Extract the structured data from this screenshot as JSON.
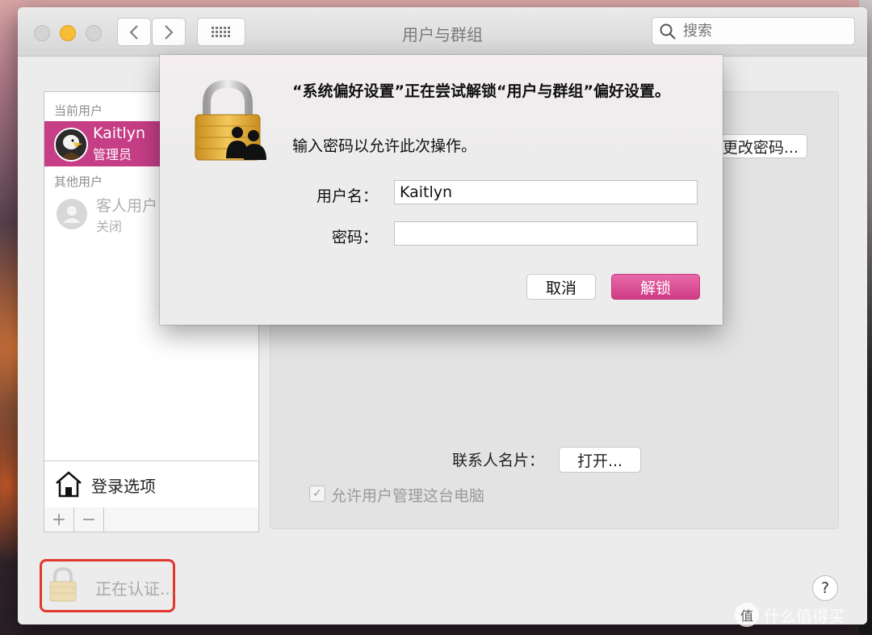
{
  "window": {
    "title": "用户与群组",
    "search_placeholder": "搜索"
  },
  "sidebar": {
    "current_user_label": "当前用户",
    "current_user": {
      "name": "Kaitlyn",
      "role": "管理员"
    },
    "other_users_label": "其他用户",
    "guest_user": {
      "name": "客人用户",
      "status": "关闭"
    },
    "login_options_label": "登录选项",
    "add_label": "+",
    "remove_label": "−"
  },
  "content": {
    "change_password_label": "更改密码...",
    "contact_card_label": "联系人名片：",
    "open_button_label": "打开...",
    "allow_admin_label": "允许用户管理这台电脑",
    "allow_admin_checked": true
  },
  "dialog": {
    "message": "“系统偏好设置”正在尝试解锁“用户与群组”偏好设置。",
    "sub_message": "输入密码以允许此次操作。",
    "username_label": "用户名：",
    "username_value": "Kaitlyn",
    "password_label": "密码：",
    "password_value": "",
    "cancel_label": "取消",
    "unlock_label": "解锁"
  },
  "footer": {
    "lock_status": "正在认证...",
    "help_label": "?"
  },
  "watermark": {
    "symbol": "值",
    "text": "什么值得买"
  },
  "colors": {
    "accent": "#c53e86",
    "unlock_button": "#e0519a",
    "highlight_border": "#e0382f",
    "close_dot": "#d4d4d4",
    "minimize_dot": "#f7be35"
  },
  "icons": [
    "back-arrow-icon",
    "forward-arrow-icon",
    "grid-icon",
    "search-icon",
    "padlock-icon",
    "users-icon",
    "house-icon",
    "person-icon",
    "help-icon"
  ]
}
